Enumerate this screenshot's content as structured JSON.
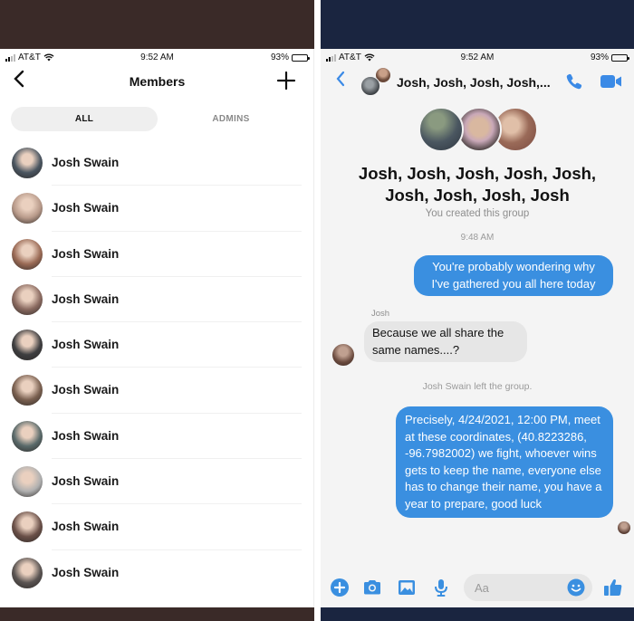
{
  "colors": {
    "messenger_blue": "#3a8fe0",
    "incoming_bubble": "#e6e6e6",
    "left_band": "#3a2a28",
    "right_band": "#1a2540"
  },
  "left_panel": {
    "status_bar": {
      "carrier": "AT&T",
      "time": "9:52 AM",
      "battery": "93%",
      "battery_level": 0.93
    },
    "nav": {
      "back_icon": "chevron-left-icon",
      "title": "Members",
      "add_icon": "plus-icon"
    },
    "tabs": [
      {
        "label": "ALL",
        "active": true
      },
      {
        "label": "ADMINS",
        "active": false
      }
    ],
    "members": [
      {
        "name": "Josh Swain",
        "avatar_color": "#4a5560"
      },
      {
        "name": "Josh Swain",
        "avatar_color": "#b89a8a"
      },
      {
        "name": "Josh Swain",
        "avatar_color": "#9a6a55"
      },
      {
        "name": "Josh Swain",
        "avatar_color": "#8a6a60"
      },
      {
        "name": "Josh Swain",
        "avatar_color": "#3e3e40"
      },
      {
        "name": "Josh Swain",
        "avatar_color": "#7a6050"
      },
      {
        "name": "Josh Swain",
        "avatar_color": "#5a6a6a"
      },
      {
        "name": "Josh Swain",
        "avatar_color": "#b0b0b0"
      },
      {
        "name": "Josh Swain",
        "avatar_color": "#6a5048"
      },
      {
        "name": "Josh Swain",
        "avatar_color": "#5a5452"
      }
    ]
  },
  "right_panel": {
    "status_bar": {
      "carrier": "AT&T",
      "time": "9:52 AM",
      "battery": "93%",
      "battery_level": 0.93
    },
    "header": {
      "title": "Josh, Josh, Josh, Josh,...",
      "back_icon": "chevron-left-icon",
      "call_icon": "phone-icon",
      "video_icon": "video-camera-icon"
    },
    "group_name": "Josh, Josh, Josh, Josh, Josh, Josh, Josh, Josh, Josh",
    "created_text": "You created this group",
    "timestamp": "9:48 AM",
    "messages": [
      {
        "direction": "outgoing",
        "text": "You're probably wondering why I've gathered you all here today"
      },
      {
        "direction": "incoming",
        "sender": "Josh",
        "text": "Because we all share the same names....?"
      },
      {
        "direction": "system",
        "text": "Josh Swain left the group."
      },
      {
        "direction": "outgoing",
        "text": "Precisely, 4/24/2021, 12:00 PM, meet at these coordinates, (40.8223286, -96.7982002) we fight, whoever wins gets to keep the name, everyone else has to change their name, you have a year to prepare, good luck"
      }
    ],
    "composer": {
      "placeholder": "Aa",
      "icons": [
        "plus-circle-icon",
        "camera-icon",
        "image-icon",
        "microphone-icon",
        "emoji-icon",
        "thumbs-up-icon"
      ]
    }
  }
}
